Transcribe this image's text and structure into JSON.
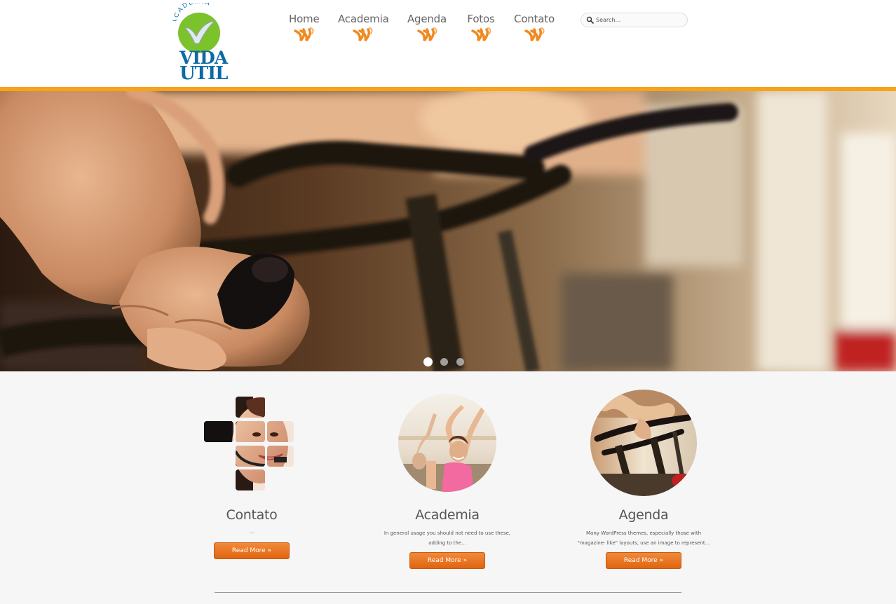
{
  "logo": {
    "academia": "ACADEMIA",
    "vida": "VIDA",
    "util": "UTIL",
    "colors": {
      "green": "#7cc22a",
      "blue": "#0e6aa6"
    }
  },
  "nav": {
    "items": [
      {
        "label": "Home"
      },
      {
        "label": "Academia"
      },
      {
        "label": "Agenda"
      },
      {
        "label": "Fotos"
      },
      {
        "label": "Contato"
      }
    ],
    "swoosh_color": "#f08a20"
  },
  "search": {
    "placeholder": "Search..."
  },
  "accent_color": "#f7a21b",
  "hero": {
    "slides": 3,
    "active_slide": 1
  },
  "features": [
    {
      "title": "Contato",
      "description": "...",
      "button": "Read More »"
    },
    {
      "title": "Academia",
      "description": "In general usage you should not need to use these, adding to the...",
      "button": "Read More »"
    },
    {
      "title": "Agenda",
      "description": "Many WordPress themes, especially those with \"magazine- like\" layouts, use an image to represent...",
      "button": "Read More »"
    }
  ]
}
